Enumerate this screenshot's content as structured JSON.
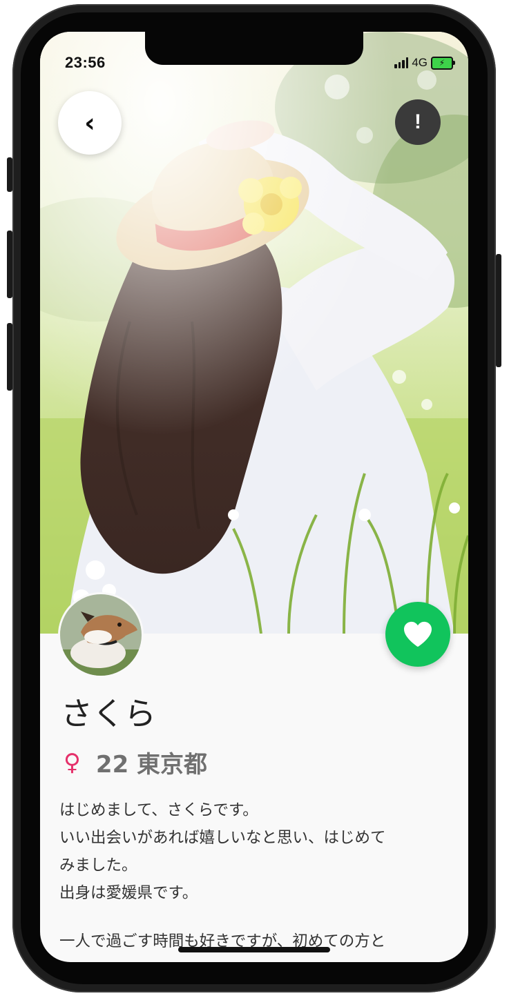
{
  "status_bar": {
    "time": "23:56",
    "network": "4G",
    "battery_icon": "battery-charging-icon",
    "signal_icon": "signal-bars-icon"
  },
  "header": {
    "back_label": "‹",
    "report_label": "!"
  },
  "profile": {
    "name": "さくら",
    "gender_symbol": "♀",
    "age_location": "22 東京都",
    "bio_lines": [
      "はじめまして、さくらです。",
      "いい出会いがあれば嬉しいなと思い、はじめて",
      "みました。",
      "出身は愛媛県です。",
      "一人で過ごす時間も好きですが、初めての方と"
    ]
  },
  "colors": {
    "like": "#11c45c",
    "gender": "#e5306a",
    "meta_text": "#707070"
  },
  "icons": {
    "like": "heart-icon",
    "back": "chevron-left-icon",
    "report": "exclamation-icon"
  }
}
